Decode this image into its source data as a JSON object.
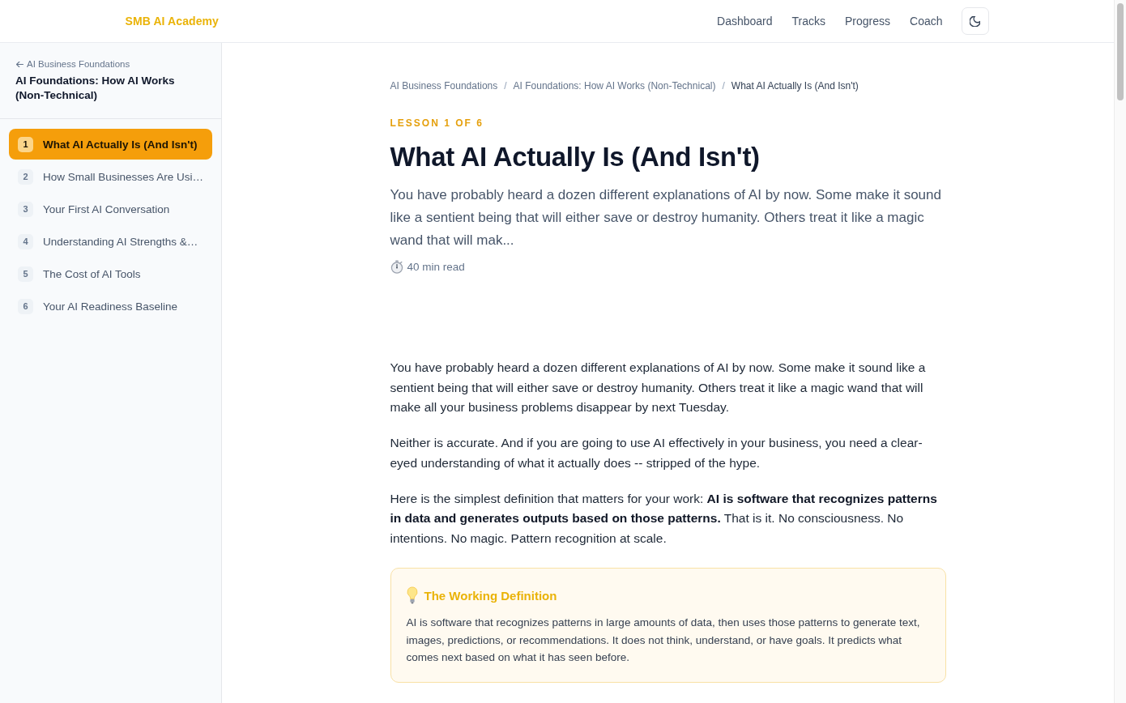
{
  "header": {
    "logo": "SMB AI Academy",
    "nav": [
      {
        "label": "Dashboard"
      },
      {
        "label": "Tracks"
      },
      {
        "label": "Progress"
      },
      {
        "label": "Coach"
      }
    ]
  },
  "sidebar": {
    "back_link": "AI Business Foundations",
    "course_title": "AI Foundations: How AI Works (Non-Technical)",
    "lessons": [
      {
        "number": "1",
        "title": "What AI Actually Is (And Isn't)",
        "selected": true
      },
      {
        "number": "2",
        "title": "How Small Businesses Are Usi…",
        "selected": false
      },
      {
        "number": "3",
        "title": "Your First AI Conversation",
        "selected": false
      },
      {
        "number": "4",
        "title": "Understanding AI Strengths &…",
        "selected": false
      },
      {
        "number": "5",
        "title": "The Cost of AI Tools",
        "selected": false
      },
      {
        "number": "6",
        "title": "Your AI Readiness Baseline",
        "selected": false
      }
    ]
  },
  "main": {
    "breadcrumbs": [
      {
        "label": "AI Business Foundations",
        "current": false,
        "separator": "/"
      },
      {
        "label": "AI Foundations: How AI Works (Non-Technical)",
        "current": false,
        "separator": "/"
      },
      {
        "label": "What AI Actually Is (And Isn't)",
        "current": true
      }
    ],
    "lesson_label": "LESSON 1 OF 6",
    "title": "What AI Actually Is (And Isn't)",
    "summary": "You have probably heard a dozen different explanations of AI by now. Some make it sound like a sentient being that will either save or destroy humanity. Others treat it like a magic wand that will mak...",
    "read_time": "40 min read",
    "body": [
      "You have probably heard a dozen different explanations of AI by now. Some make it sound like a sentient being that will either save or destroy humanity. Others treat it like a magic wand that will make all your business problems disappear by next Tuesday.",
      "Neither is accurate. And if you are going to use AI effectively in your business, you need a clear-eyed understanding of what it actually does -- stripped of the hype.",
      "Here is the simplest definition that matters for your work: **AI is software that recognizes patterns in data and generates outputs based on those patterns.** That is it. No consciousness. No intentions. No magic. Pattern recognition at scale."
    ],
    "callout": {
      "title": "The Working Definition",
      "text": "AI is software that recognizes patterns in large amounts of data, then uses those patterns to generate text, images, predictions, or recommendations. It does not think, understand, or have goals. It predicts what comes next based on what it has seen before."
    }
  }
}
